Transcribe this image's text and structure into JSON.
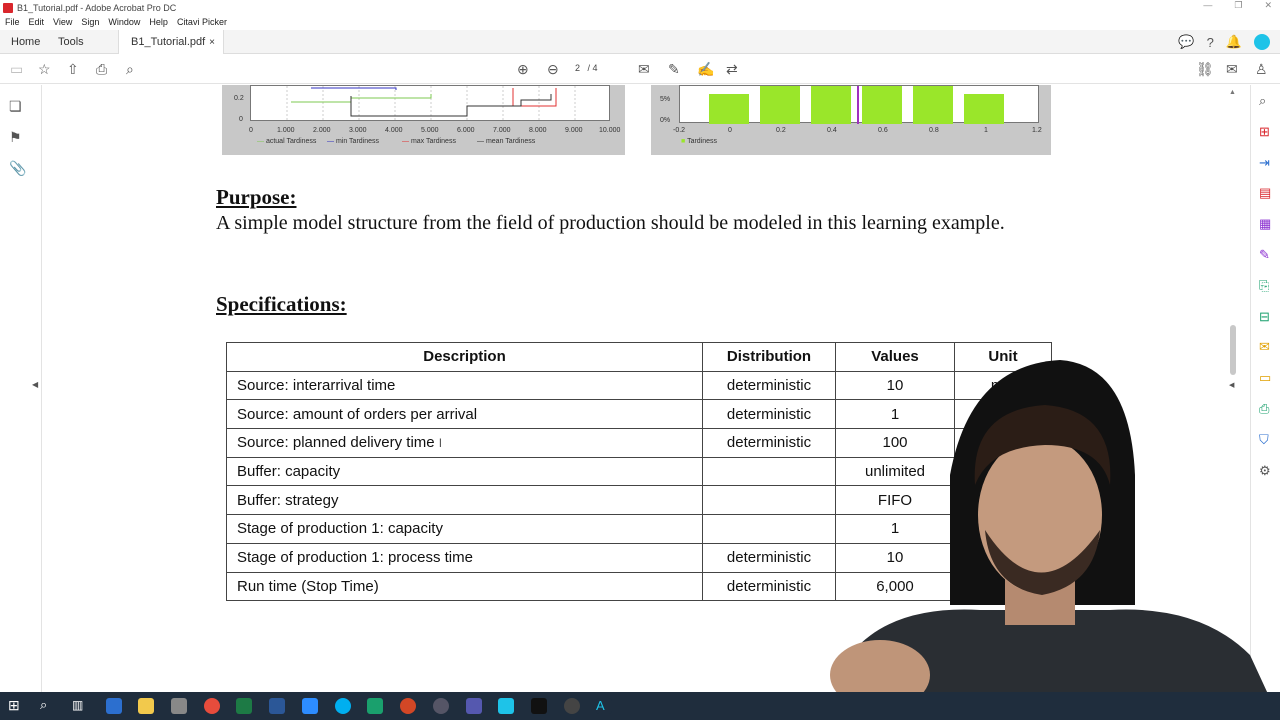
{
  "window": {
    "title": "B1_Tutorial.pdf - Adobe Acrobat Pro DC"
  },
  "menu": [
    "File",
    "Edit",
    "View",
    "Sign",
    "Window",
    "Help",
    "Citavi Picker"
  ],
  "tabs": {
    "home": "Home",
    "tools": "Tools",
    "doc": "B1_Tutorial.pdf",
    "close": "×"
  },
  "toolbar": {
    "page_current": "2",
    "page_total": "/ 4"
  },
  "chart_data": [
    {
      "type": "line",
      "x_ticks": [
        "0",
        "1.000",
        "2.000",
        "3.000",
        "4.000",
        "5.000",
        "6.000",
        "7.000",
        "8.000",
        "9.000",
        "10.000"
      ],
      "y_ticks": [
        "0",
        "0.2"
      ],
      "series": [
        {
          "name": "actual Tardiness",
          "color": "#7ec850"
        },
        {
          "name": "min Tardiness",
          "color": "#3030c0"
        },
        {
          "name": "max Tardiness",
          "color": "#e03030"
        },
        {
          "name": "mean Tardiness",
          "color": "#333333"
        }
      ]
    },
    {
      "type": "bar",
      "x_ticks": [
        "-0.2",
        "0",
        "0.2",
        "0.4",
        "0.6",
        "0.8",
        "1",
        "1.2"
      ],
      "y_ticks": [
        "0%",
        "5%"
      ],
      "series": [
        {
          "name": "Tardiness",
          "color": "#9ae62a"
        }
      ]
    }
  ],
  "doc": {
    "purpose_heading": "Purpose:",
    "purpose_text": "A simple model structure from the field of production should be modeled in this learning example.",
    "spec_heading": "Specifications:",
    "table": {
      "headers": [
        "Description",
        "Distribution",
        "Values",
        "Unit"
      ],
      "rows": [
        [
          "Source: interarrival time",
          "deterministic",
          "10",
          "min"
        ],
        [
          "Source: amount of orders per arrival",
          "deterministic",
          "1",
          ""
        ],
        [
          "Source: planned delivery time",
          "deterministic",
          "100",
          ""
        ],
        [
          "Buffer: capacity",
          "",
          "unlimited",
          ""
        ],
        [
          "Buffer: strategy",
          "",
          "FIFO",
          ""
        ],
        [
          "Stage of production 1: capacity",
          "",
          "1",
          ""
        ],
        [
          "Stage of production 1: process time",
          "deterministic",
          "10",
          ""
        ],
        [
          "Run time (Stop Time)",
          "deterministic",
          "6,000",
          ""
        ]
      ]
    }
  }
}
